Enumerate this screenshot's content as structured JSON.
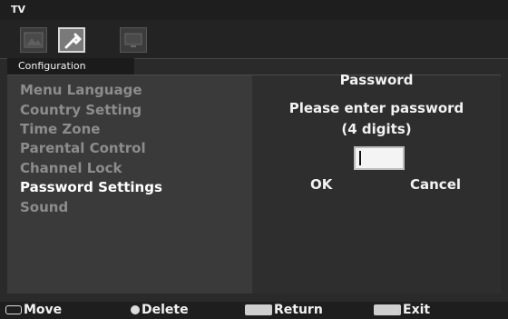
{
  "window": {
    "title": "TV"
  },
  "icons": [
    {
      "name": "picture-icon"
    },
    {
      "name": "tools-icon"
    },
    {
      "name": "tv-icon"
    }
  ],
  "section": {
    "title": "Configuration"
  },
  "menu": {
    "items": [
      {
        "label": "Menu Language",
        "active": false
      },
      {
        "label": "Country Setting",
        "active": false
      },
      {
        "label": "Time Zone",
        "active": false
      },
      {
        "label": "Parental Control",
        "active": false
      },
      {
        "label": "Channel Lock",
        "active": false
      },
      {
        "label": "Password Settings",
        "active": true
      },
      {
        "label": "Sound",
        "active": false
      }
    ]
  },
  "password": {
    "title": "Password",
    "message_line1": "Please enter password",
    "message_line2": "(4 digits)",
    "input_value": "",
    "ok_label": "OK",
    "cancel_label": "Cancel"
  },
  "help": {
    "move": "Move",
    "delete": "Delete",
    "return": "Return",
    "exit": "Exit"
  }
}
